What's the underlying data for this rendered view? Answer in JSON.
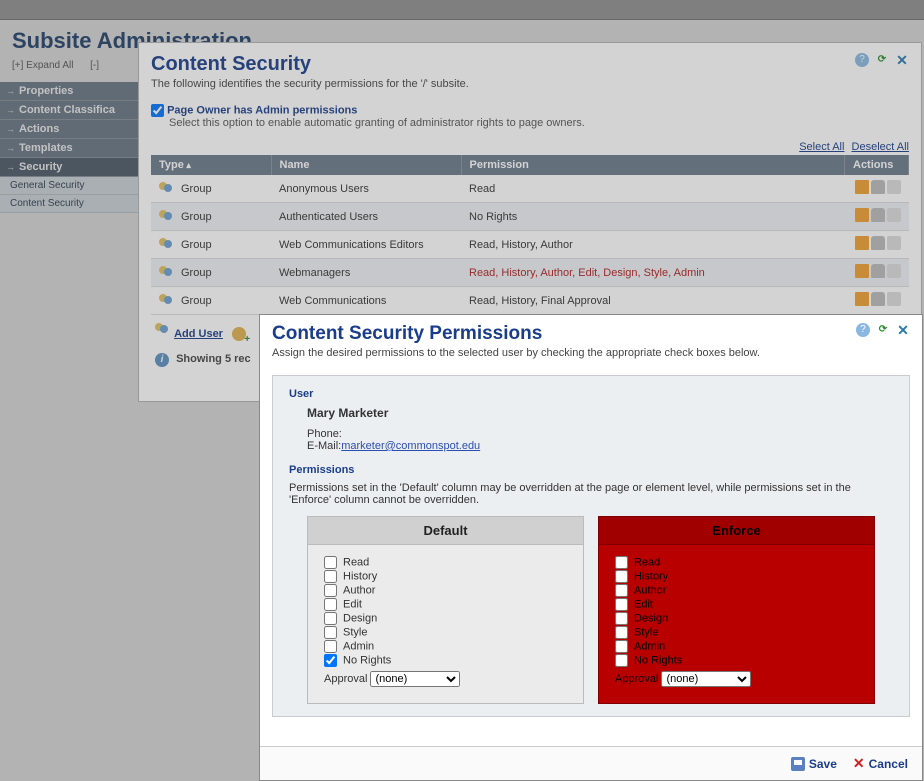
{
  "page": {
    "title": "Subsite Administration",
    "expand_all": "[+] Expand All",
    "collapse_all": "[-]"
  },
  "sidebar": {
    "items": [
      {
        "label": "Properties"
      },
      {
        "label": "Content Classifica"
      },
      {
        "label": "Actions"
      },
      {
        "label": "Templates"
      },
      {
        "label": "Security"
      }
    ],
    "sub_items": [
      {
        "label": "General Security"
      },
      {
        "label": "Content Security"
      }
    ]
  },
  "dialog1": {
    "title": "Content Security",
    "subtitle": "The following identifies the security permissions for the '/' subsite.",
    "admin_opt_label": "Page Owner has Admin permissions",
    "admin_opt_desc": "Select this option to enable automatic granting of administrator rights to page owners.",
    "select_all": "Select All",
    "deselect_all": "Deselect All",
    "cols": {
      "type": "Type",
      "name": "Name",
      "permission": "Permission",
      "actions": "Actions"
    },
    "rows": [
      {
        "type": "Group",
        "name": "Anonymous Users",
        "perm": "Read",
        "highlight": false
      },
      {
        "type": "Group",
        "name": "Authenticated Users",
        "perm": "No Rights",
        "highlight": false
      },
      {
        "type": "Group",
        "name": "Web Communications Editors",
        "perm": "Read, History, Author",
        "highlight": false
      },
      {
        "type": "Group",
        "name": "Webmanagers",
        "perm": "Read, History, Author, Edit, Design, Style, Admin",
        "highlight": true
      },
      {
        "type": "Group",
        "name": "Web Communications",
        "perm": "Read, History, Final Approval",
        "highlight": false
      }
    ],
    "add_user": "Add User",
    "status": "Showing 5 rec"
  },
  "dialog2": {
    "title": "Content Security Permissions",
    "subtitle": "Assign the desired permissions to the selected user by checking the appropriate check boxes below.",
    "user_section": "User",
    "user_name": "Mary Marketer",
    "phone_label": "Phone:",
    "email_label": "E-Mail:",
    "email_value": "marketer@commonspot.edu",
    "perm_section": "Permissions",
    "perm_desc": "Permissions set in the 'Default' column may be overridden at the page or element level, while permissions set in the 'Enforce' column cannot be overridden.",
    "default_hdr": "Default",
    "enforce_hdr": "Enforce",
    "perm_labels": [
      "Read",
      "History",
      "Author",
      "Edit",
      "Design",
      "Style",
      "Admin",
      "No Rights"
    ],
    "default_checked": [
      false,
      false,
      false,
      false,
      false,
      false,
      false,
      true
    ],
    "enforce_checked": [
      false,
      false,
      false,
      false,
      false,
      false,
      false,
      false
    ],
    "approval_label": "Approval",
    "approval_none": "(none)",
    "save_label": "Save",
    "cancel_label": "Cancel"
  }
}
